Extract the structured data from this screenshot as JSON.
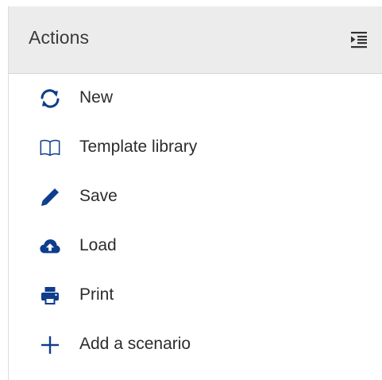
{
  "panel": {
    "title": "Actions",
    "accent_color": "#0d3d8c",
    "collapse_icon": "indent-collapse-icon"
  },
  "items": [
    {
      "label": "New",
      "icon": "refresh-icon"
    },
    {
      "label": "Template library",
      "icon": "book-icon"
    },
    {
      "label": "Save",
      "icon": "pencil-icon"
    },
    {
      "label": "Load",
      "icon": "cloud-upload-icon"
    },
    {
      "label": "Print",
      "icon": "printer-icon"
    },
    {
      "label": "Add a scenario",
      "icon": "plus-icon"
    }
  ]
}
